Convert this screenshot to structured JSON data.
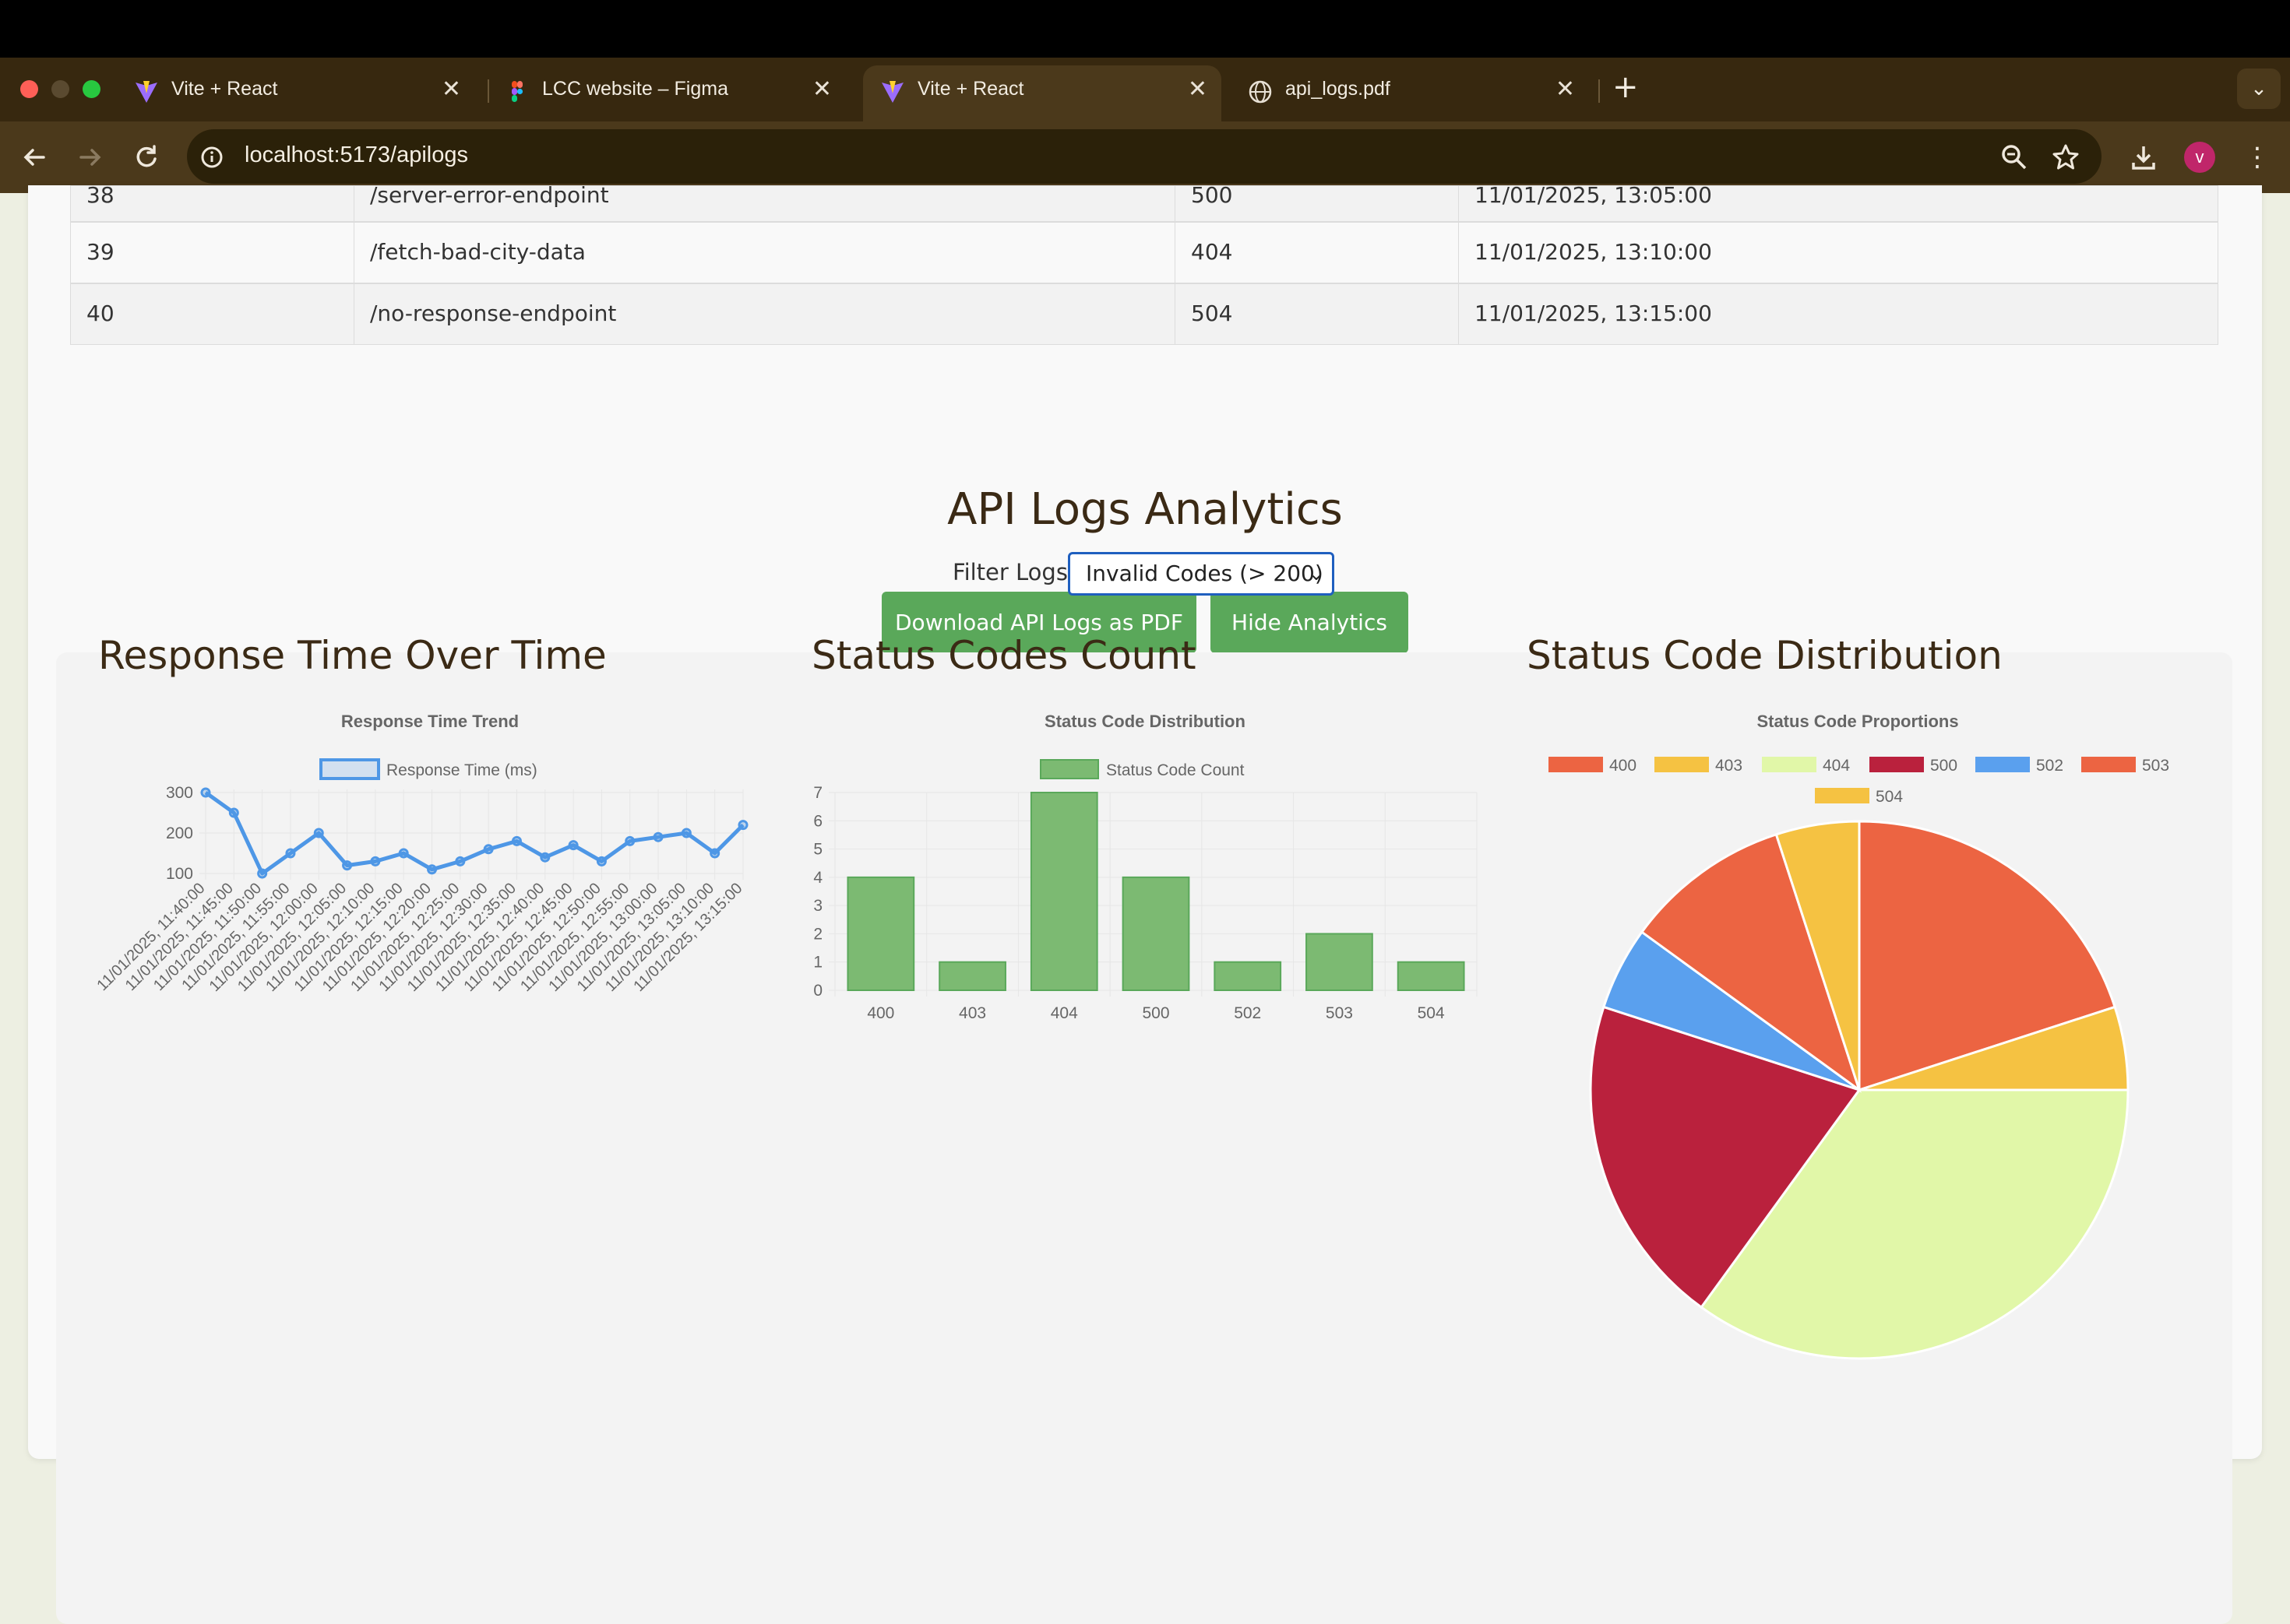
{
  "browser": {
    "tabs": [
      {
        "label": "Vite + React",
        "icon": "vite-icon"
      },
      {
        "label": "LCC website – Figma",
        "icon": "figma-icon"
      },
      {
        "label": "Vite + React",
        "icon": "vite-icon"
      },
      {
        "label": "api_logs.pdf",
        "icon": "globe-icon"
      }
    ],
    "active_tab": 2,
    "url": "localhost:5173/apilogs",
    "profile_initial": "v"
  },
  "table": {
    "rows": [
      {
        "id": "38",
        "endpoint": "/server-error-endpoint",
        "status": "500",
        "timestamp": "11/01/2025, 13:05:00"
      },
      {
        "id": "39",
        "endpoint": "/fetch-bad-city-data",
        "status": "404",
        "timestamp": "11/01/2025, 13:10:00"
      },
      {
        "id": "40",
        "endpoint": "/no-response-endpoint",
        "status": "504",
        "timestamp": "11/01/2025, 13:15:00"
      }
    ]
  },
  "actions": {
    "download_label": "Download API Logs as PDF",
    "hide_label": "Hide Analytics"
  },
  "analytics": {
    "title": "API Logs Analytics",
    "filter_label": "Filter Logs:",
    "filter_value": "Invalid Codes (> 200)",
    "headings": {
      "response": "Response Time Over Time",
      "count": "Status Codes Count",
      "distribution": "Status Code Distribution"
    }
  },
  "chart_data": [
    {
      "type": "line",
      "title": "Response Time Trend",
      "series": [
        {
          "name": "Response Time (ms)",
          "values": [
            300,
            250,
            100,
            150,
            200,
            120,
            130,
            150,
            110,
            130,
            160,
            180,
            140,
            170,
            130,
            180,
            190,
            200,
            150,
            220
          ]
        }
      ],
      "x": [
        "11/01/2025, 11:40:00",
        "11/01/2025, 11:45:00",
        "11/01/2025, 11:50:00",
        "11/01/2025, 11:55:00",
        "11/01/2025, 12:00:00",
        "11/01/2025, 12:05:00",
        "11/01/2025, 12:10:00",
        "11/01/2025, 12:15:00",
        "11/01/2025, 12:20:00",
        "11/01/2025, 12:25:00",
        "11/01/2025, 12:30:00",
        "11/01/2025, 12:35:00",
        "11/01/2025, 12:40:00",
        "11/01/2025, 12:45:00",
        "11/01/2025, 12:50:00",
        "11/01/2025, 12:55:00",
        "11/01/2025, 13:00:00",
        "11/01/2025, 13:05:00",
        "11/01/2025, 13:10:00",
        "11/01/2025, 13:15:00"
      ],
      "yticks": [
        100,
        200,
        300
      ],
      "ylim": [
        100,
        300
      ],
      "color": "#4e97e6",
      "legend": "top"
    },
    {
      "type": "bar",
      "title": "Status Code Distribution",
      "categories": [
        "400",
        "403",
        "404",
        "500",
        "502",
        "503",
        "504"
      ],
      "series": [
        {
          "name": "Status Code Count",
          "values": [
            4,
            1,
            7,
            4,
            1,
            2,
            1
          ]
        }
      ],
      "ylim": [
        0,
        7
      ],
      "yticks": [
        0,
        1,
        2,
        3,
        4,
        5,
        6,
        7
      ],
      "color": "#7cba72",
      "legend": "top"
    },
    {
      "type": "pie",
      "title": "Status Code Proportions",
      "categories": [
        "400",
        "403",
        "404",
        "500",
        "502",
        "503",
        "504"
      ],
      "values": [
        4,
        1,
        7,
        4,
        1,
        2,
        1
      ],
      "colors": [
        "#ec6442",
        "#f5c242",
        "#e1f7a8",
        "#ba213d",
        "#5aa0ee",
        "#ec6442",
        "#f5c242"
      ],
      "legend": "top"
    }
  ]
}
